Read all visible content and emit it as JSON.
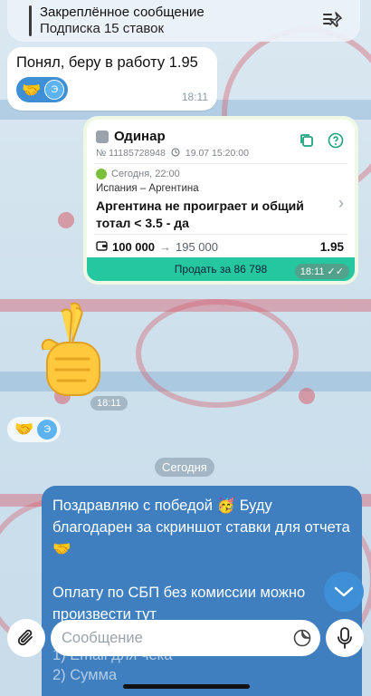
{
  "pinned": {
    "title": "Закреплённое сообщение",
    "subtitle": "Подписка 15 ставок"
  },
  "msg1": {
    "text": "Понял, беру в работу 1.95",
    "reaction_emoji": "🤝",
    "reaction_avatar": "Э",
    "time": "18:11"
  },
  "bet": {
    "type": "Одинар",
    "number": "№ 11185728948",
    "date": "19.07 15:20:00",
    "event_date": "Сегодня, 22:00",
    "match": "Испания – Аргентина",
    "outcome": "Аргентина не проиграет и общий тотал < 3.5 - да",
    "stake": "100 000",
    "arrow": "→",
    "win": "195 000",
    "odds": "1.95",
    "sell_label": "Продать за 86 798",
    "time": "18:11"
  },
  "sticker": {
    "emoji": "🤞",
    "time": "18:11"
  },
  "reaction2": {
    "emoji": "🤝",
    "avatar": "Э"
  },
  "date_divider": "Сегодня",
  "msg_blue": {
    "line1": "Поздравляю с победой 🥳 Буду благодарен за скриншот ставки для отчета 🤝",
    "line2": "Оплату по СБП без комиссии можно произвести тут",
    "line3": "1) Email для чека",
    "line4": "2) Сумма"
  },
  "input": {
    "placeholder": "Сообщение"
  },
  "icons": {
    "pin": "pin-list-icon",
    "copy": "copy-icon",
    "help": "help-icon",
    "scroll": "chevron-down-icon",
    "attach": "paperclip-icon",
    "sticker": "sticker-icon",
    "mic": "microphone-icon"
  },
  "colors": {
    "accent": "#3f8fd6",
    "sell": "#24c7a0",
    "bubble_blue": "#3f7fc0"
  }
}
